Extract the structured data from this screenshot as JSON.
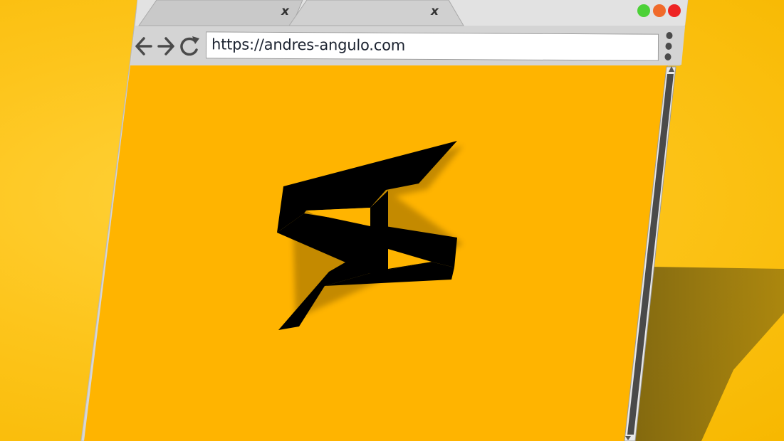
{
  "browser": {
    "tabs": [
      {
        "label": "",
        "close_glyph": "x"
      },
      {
        "label": "",
        "close_glyph": "x"
      }
    ],
    "window_controls": [
      {
        "name": "minimize",
        "color": "#4cd137"
      },
      {
        "name": "maximize",
        "color": "#f06a2a"
      },
      {
        "name": "close",
        "color": "#ee2323"
      }
    ],
    "url": "https://andres-angulo.com",
    "toolbar_icons": [
      "back-arrow-icon",
      "forward-arrow-icon",
      "reload-icon",
      "more-options-icon"
    ],
    "page": {
      "background": "#ffb400",
      "logo": "andres-angulo-logo"
    }
  },
  "colors": {
    "background": "#fdc51c",
    "chrome": "#d4d4d4",
    "logo": "#000000",
    "scrollbar": "#4a4a4a"
  }
}
